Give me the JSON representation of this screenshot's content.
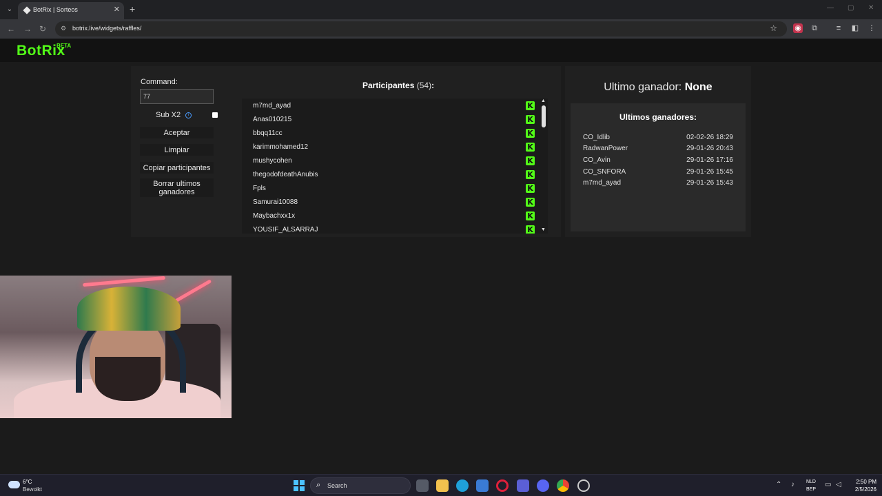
{
  "browser": {
    "tab_title": "BotRix | Sorteos",
    "url": "botrix.live/widgets/raffles/",
    "new_tab_glyph": "+",
    "close_glyph": "✕"
  },
  "site": {
    "logo": "BotRix",
    "logo_badge": "BETA"
  },
  "raffle": {
    "command_label": "Command:",
    "command_value": "77",
    "sub_label": "Sub X2",
    "sub_checked": false,
    "buttons": {
      "accept": "Aceptar",
      "clear": "Limpiar",
      "copy": "Copiar participantes",
      "delete_winners": "Borrar ultimos ganadores"
    },
    "participants_title": "Participantes",
    "participants_count": "(54)",
    "participants_colon": ":",
    "participants": [
      "m7md_ayad",
      "Anas010215",
      "bbqq11cc",
      "karimmohamed12",
      "mushycohen",
      "thegodofdeathAnubis",
      "Fpls",
      "Samurai10088",
      "Maybachxx1x",
      "YOUSIF_ALSARRAJ"
    ],
    "platform_icon": "kick-icon"
  },
  "winners": {
    "last_winner_label": "Ultimo ganador:",
    "last_winner_value": "None",
    "list_title": "Ultimos ganadores:",
    "list": [
      {
        "name": "CO_Idlib",
        "date": "02-02-26 18:29"
      },
      {
        "name": "RadwanPower",
        "date": "29-01-26 20:43"
      },
      {
        "name": "CO_Avin",
        "date": "29-01-26 17:16"
      },
      {
        "name": "CO_SNFORA",
        "date": "29-01-26 15:45"
      },
      {
        "name": "m7md_ayad",
        "date": "29-01-26 15:43"
      }
    ]
  },
  "taskbar": {
    "temperature": "6°C",
    "weather": "Bewolkt",
    "search_placeholder": "Search",
    "lang_top": "NLD",
    "lang_bottom": "BEP",
    "time": "2:50 PM",
    "date": "2/5/2026"
  },
  "colors": {
    "accent": "#53fc18",
    "panel": "#202020",
    "background": "#1b1b1b"
  }
}
